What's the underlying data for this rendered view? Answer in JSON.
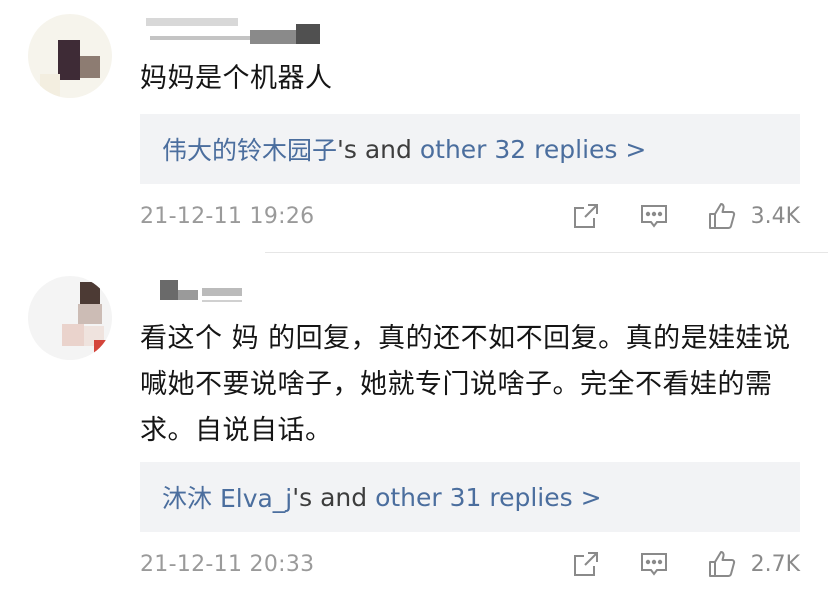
{
  "comments": [
    {
      "text": "妈妈是个机器人",
      "replies": {
        "prefix": "伟大的铃木园子",
        "middle": "'s and ",
        "link": "other 32 replies >"
      },
      "timestamp": "21-12-11 19:26",
      "likes": "3.4K"
    },
    {
      "text": "看这个 妈 的回复，真的还不如不回复。真的是娃娃说 喊她不要说啥子，她就专门说啥子。完全不看娃的需求。自说自话。",
      "replies": {
        "prefix": "沐沐 Elva_j",
        "middle": "'s and ",
        "link": "other 31 replies >"
      },
      "timestamp": "21-12-11 20:33",
      "likes": "2.7K"
    }
  ],
  "colors": {
    "link_blue": "#4b6e9e",
    "reply_bg": "#f2f3f5",
    "meta_gray": "#9a9a9a"
  },
  "icons": [
    "share-icon",
    "comment-icon",
    "thumbs-up-icon"
  ]
}
